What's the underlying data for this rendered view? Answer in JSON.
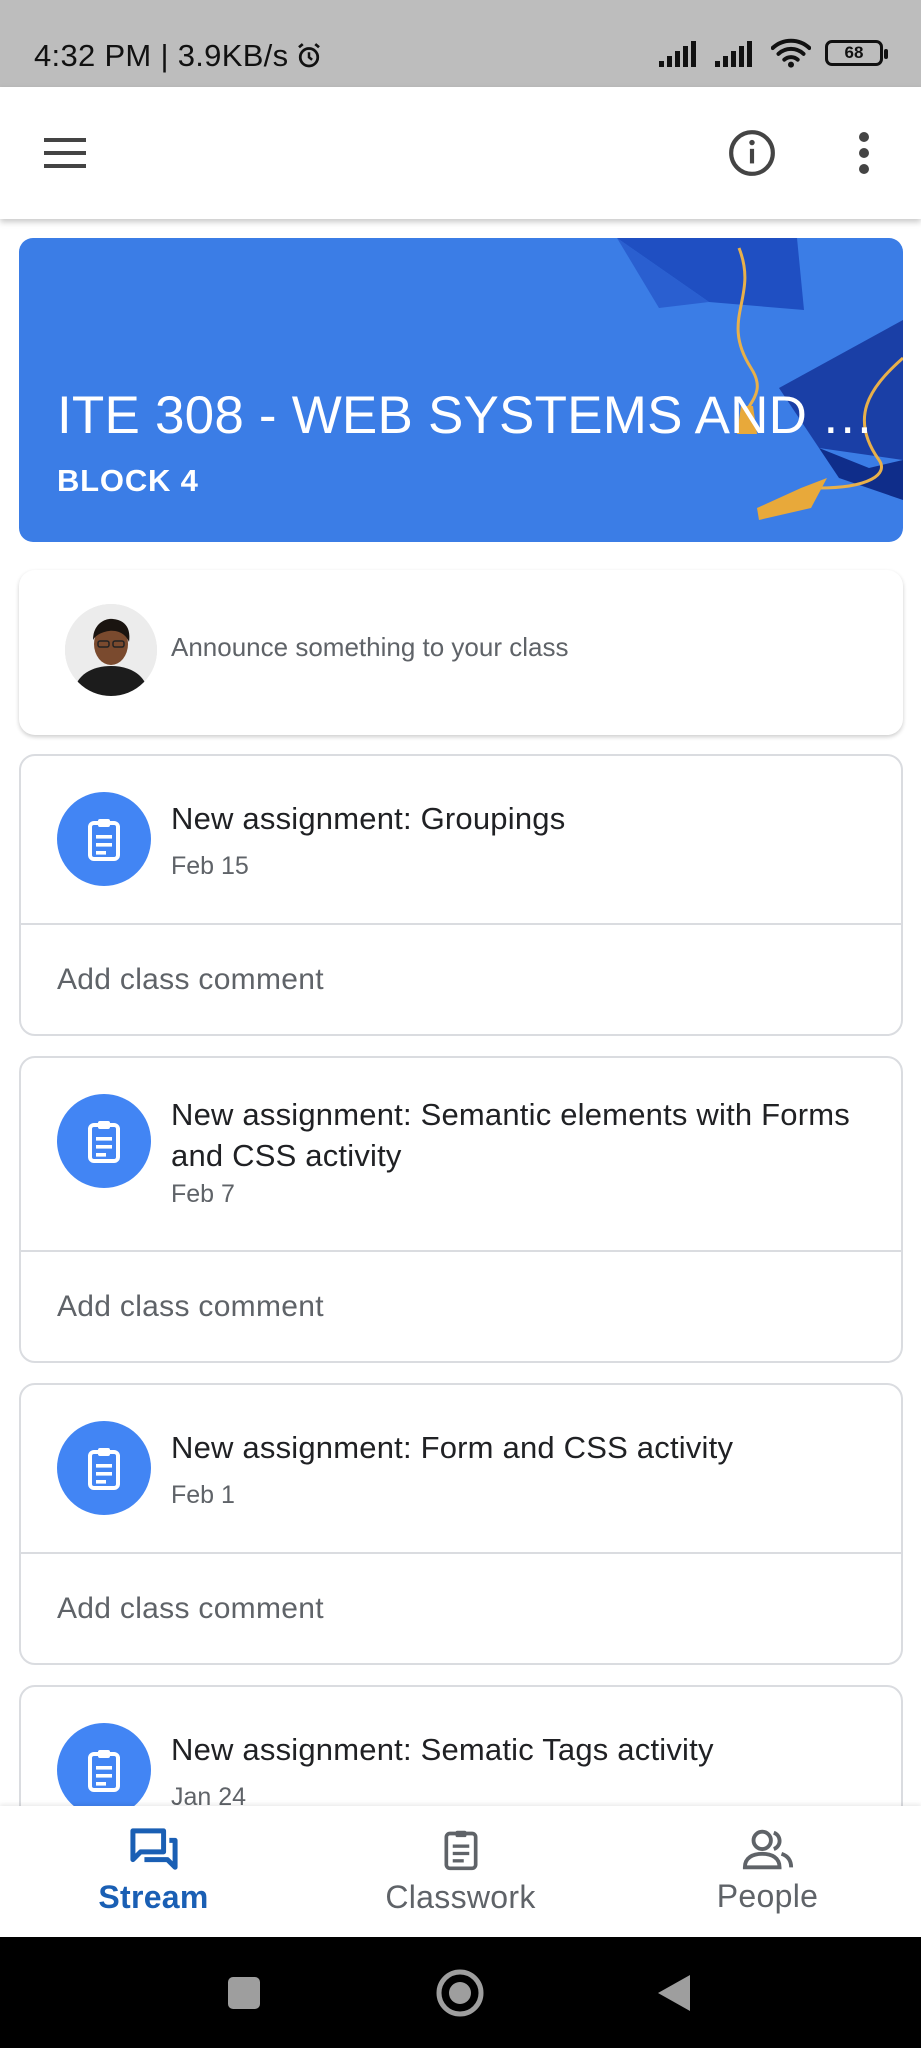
{
  "status_bar": {
    "time": "4:32 PM | 3.9KB/s",
    "battery": "68"
  },
  "app_bar": {
    "menu_icon": "menu-icon",
    "info_icon": "info-icon",
    "more_icon": "more-vert-icon"
  },
  "banner": {
    "title": "ITE 308 - WEB SYSTEMS AND T...",
    "subtitle": "BLOCK 4",
    "color": "#3b7de6"
  },
  "announce": {
    "placeholder": "Announce something to your class"
  },
  "posts": [
    {
      "title": "New assignment: Groupings",
      "date": "Feb 15",
      "comment": "Add class comment"
    },
    {
      "title": "New assignment: Semantic elements with Forms and CSS activity",
      "date": "Feb 7",
      "comment": "Add class comment"
    },
    {
      "title": "New assignment: Form and CSS activity",
      "date": "Feb 1",
      "comment": "Add class comment"
    },
    {
      "title": "New assignment: Sematic Tags activity",
      "date": "Jan 24"
    }
  ],
  "bottom_nav": {
    "items": [
      {
        "label": "Stream",
        "icon": "stream-icon",
        "active": true
      },
      {
        "label": "Classwork",
        "icon": "classwork-icon",
        "active": false
      },
      {
        "label": "People",
        "icon": "people-icon",
        "active": false
      }
    ],
    "active_color": "#1a5fb4"
  },
  "system_nav": {
    "recents_icon": "recents-square-icon",
    "home_icon": "home-circle-icon",
    "back_icon": "back-triangle-icon"
  }
}
